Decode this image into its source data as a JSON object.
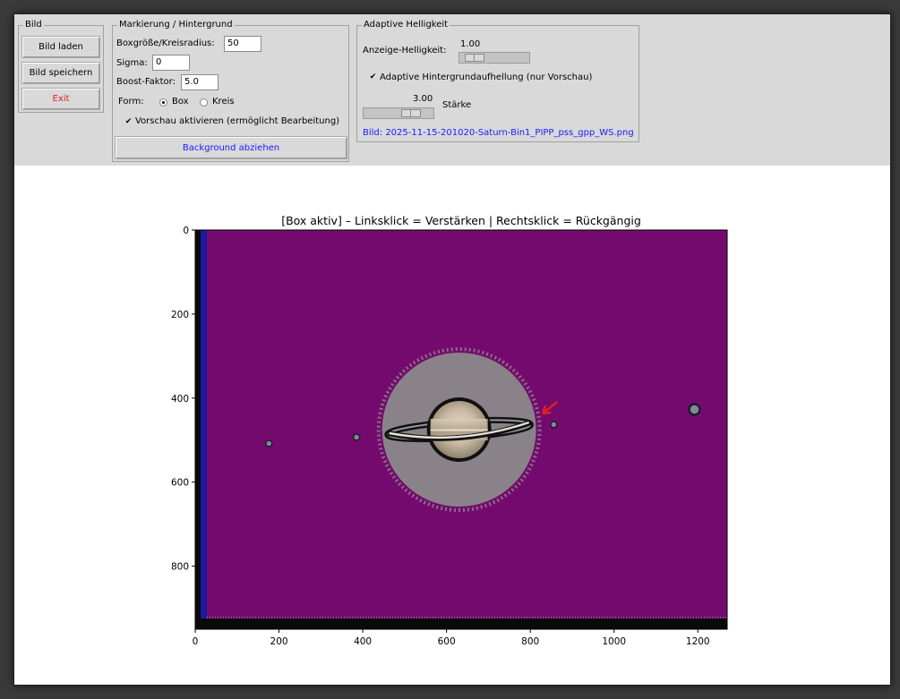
{
  "groups": {
    "bild": {
      "title": "Bild",
      "load_label": "Bild laden",
      "save_label": "Bild speichern",
      "exit_label": "Exit",
      "exit_color": "#e02020"
    },
    "markierung": {
      "title": "Markierung / Hintergrund",
      "box_size_label": "Boxgröße/Kreisradius:",
      "box_size_value": "50",
      "sigma_label": "Sigma:",
      "sigma_value": "0",
      "boost_label": "Boost-Faktor:",
      "boost_value": "5.0",
      "form_label": "Form:",
      "option_box": "Box",
      "option_kreis": "Kreis",
      "selected_form": "Box",
      "preview_label": "Vorschau aktivieren (ermöglicht Bearbeitung)",
      "preview_checked": true,
      "subtract_label": "Background abziehen",
      "subtract_color": "#1a1aff"
    },
    "adaptive": {
      "title": "Adaptive Helligkeit",
      "brightness_label": "Anzeige-Helligkeit:",
      "brightness_value": "1.00",
      "brightness_fraction": 0.1,
      "adaptive_label": "Adaptive Hintergrundaufhellung (nur Vorschau)",
      "adaptive_checked": true,
      "strength_value": "3.00",
      "strength_label": "Stärke",
      "strength_fraction": 0.75,
      "file_label": "Bild: 2025-11-15-201020-Saturn-Bin1_PIPP_pss_gpp_WS.png",
      "file_color": "#1a1aff"
    }
  },
  "plot": {
    "title": "[Box aktiv] – Linksklick = Verstärken | Rechtsklick = Rückgängig",
    "background_color": "#750a6e",
    "left_border_color": "#1a1aa0",
    "x_ticks": [
      "0",
      "200",
      "400",
      "600",
      "800",
      "1000",
      "1200"
    ],
    "y_ticks": [
      "0",
      "200",
      "400",
      "600",
      "800"
    ],
    "xlim": [
      0,
      1270
    ],
    "ylim": [
      0,
      950
    ],
    "planet": {
      "name": "Saturn",
      "cx": 630,
      "cy": 475
    },
    "moons": [
      {
        "x": 176,
        "y": 508
      },
      {
        "x": 385,
        "y": 493
      },
      {
        "x": 856,
        "y": 463
      },
      {
        "x": 1192,
        "y": 427
      }
    ],
    "marker_color": "#e02020"
  }
}
